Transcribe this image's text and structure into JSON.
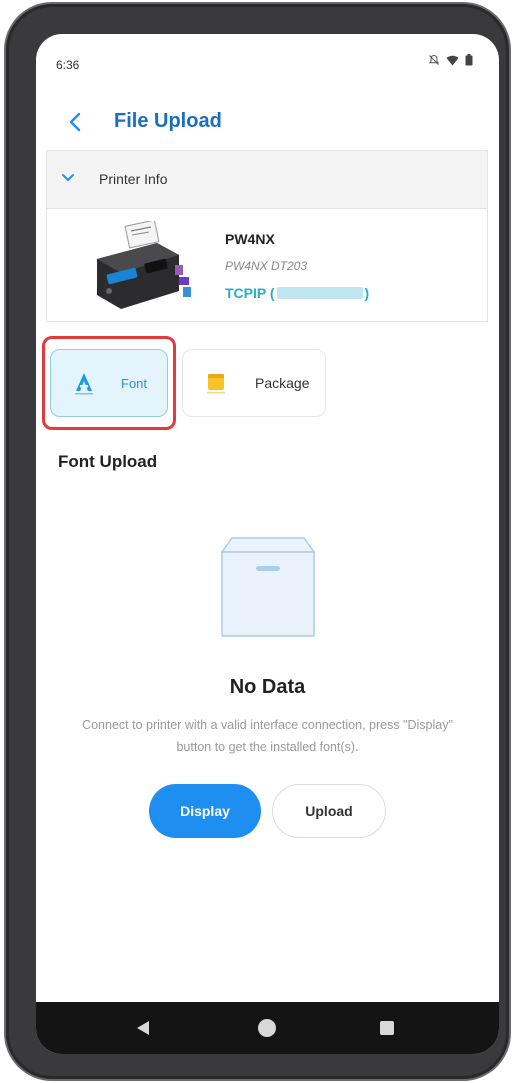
{
  "status_bar": {
    "time": "6:36",
    "icons": [
      "mute-icon",
      "wifi-icon",
      "battery-icon"
    ]
  },
  "header": {
    "title": "File Upload"
  },
  "printer_info": {
    "label": "Printer Info",
    "name": "PW4NX",
    "model": "PW4NX DT203",
    "connection_prefix": "TCPIP (",
    "connection_suffix": ")"
  },
  "tabs": [
    {
      "label": "Font",
      "selected": true
    },
    {
      "label": "Package",
      "selected": false
    }
  ],
  "section_title": "Font Upload",
  "empty_state": {
    "title": "No Data",
    "description": "Connect to printer with a valid interface connection, press \"Display\" button to get the installed font(s)."
  },
  "buttons": {
    "display": "Display",
    "upload": "Upload"
  },
  "colors": {
    "accent": "#1f8ef1",
    "title": "#1a6dc2",
    "connection": "#25b0c8",
    "highlight": "#e43a3a"
  }
}
